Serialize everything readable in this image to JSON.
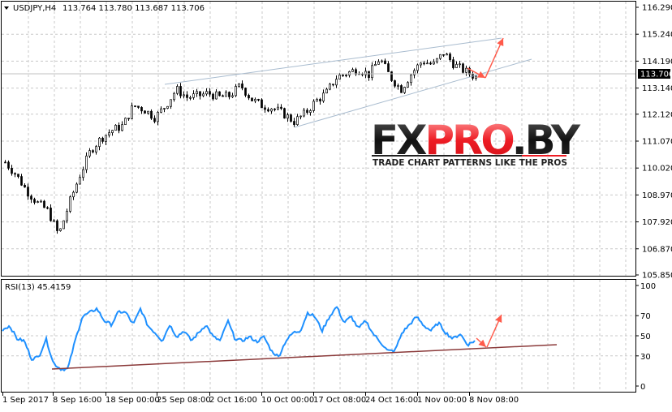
{
  "header": {
    "symbol": "USDJPY,H4",
    "ohlc": "113.764 113.780 113.687 113.706"
  },
  "logo": {
    "text_main": "FXPRO.BY",
    "tagline": "TRADE CHART PATTERNS LIKE THE PROS"
  },
  "colors": {
    "rsi_line": "#1e90ff",
    "arrow": "#ff5a4a",
    "channel": "#a9bccf",
    "rsi_trend": "#8b3a3a",
    "price_tag_bg": "#000000"
  },
  "chart_data": [
    {
      "type": "candlestick",
      "title": "USDJPY,H4",
      "current_price": "113.706",
      "ylim": [
        105.85,
        116.29
      ],
      "y_ticks": [
        "116.290",
        "115.240",
        "114.190",
        "113.140",
        "112.120",
        "111.070",
        "110.020",
        "108.970",
        "107.920",
        "106.870",
        "105.850"
      ],
      "x_ticks": [
        "1 Sep 2017",
        "8 Sep 16:00",
        "18 Sep 00:00",
        "25 Sep 08:00",
        "2 Oct 16:00",
        "10 Oct 00:00",
        "17 Oct 08:00",
        "24 Oct 16:00",
        "1 Nov 00:00",
        "8 Nov 08:00"
      ],
      "grid": true,
      "close_approx": [
        110.25,
        109.77,
        109.14,
        108.66,
        108.35,
        107.4,
        108.66,
        109.77,
        110.72,
        111.2,
        111.5,
        111.67,
        112.46,
        112.3,
        111.99,
        112.46,
        113.09,
        112.78,
        112.84,
        112.94,
        112.78,
        112.84,
        113.25,
        112.71,
        112.46,
        112.37,
        112.14,
        111.83,
        112.14,
        112.62,
        112.94,
        113.57,
        113.73,
        113.89,
        113.66,
        114.3,
        113.57,
        113.09,
        113.73,
        114.2,
        114.04,
        114.52,
        114.04,
        113.79,
        113.57
      ]
    },
    {
      "type": "line",
      "title": "RSI(13) 45.4159",
      "ylim": [
        0,
        100
      ],
      "y_ticks": [
        "100",
        "70",
        "50",
        "30",
        "0"
      ],
      "grid": true,
      "values_approx": [
        56,
        60,
        47,
        45,
        27,
        29,
        47,
        23,
        17,
        17,
        45,
        69,
        73,
        77,
        65,
        61,
        74,
        73,
        61,
        77,
        60,
        53,
        45,
        61,
        49,
        55,
        45,
        53,
        61,
        49,
        45,
        65,
        47,
        45,
        49,
        44,
        49,
        35,
        29,
        45,
        53,
        55,
        73,
        69,
        55,
        69,
        79,
        63,
        69,
        57,
        65,
        52,
        44,
        35,
        35,
        53,
        61,
        69,
        60,
        55,
        63,
        53,
        47,
        52,
        41,
        45
      ]
    }
  ]
}
